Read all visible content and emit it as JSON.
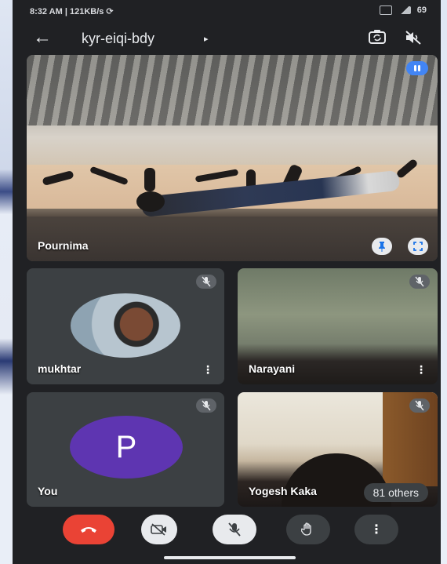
{
  "status_bar": {
    "time_speed": "8:32 AM | 121KB/s ⟳",
    "battery": "69"
  },
  "meeting": {
    "code": "kyr-eiqi-bdy",
    "caret": "▸",
    "back_glyph": "←"
  },
  "main_tile": {
    "participant": "Pournima"
  },
  "tiles": [
    {
      "participant": "mukhtar",
      "muted": true
    },
    {
      "participant": "Narayani",
      "muted": true
    },
    {
      "participant": "You",
      "avatar_letter": "P",
      "muted": true
    },
    {
      "participant": "Yogesh Kaka",
      "muted": true
    }
  ],
  "others_count_label": "81 others",
  "icons": {
    "back": "arrow-left-icon",
    "switch_camera": "switch-camera-icon",
    "speaker": "speaker-off-icon",
    "pin": "pin-icon",
    "fullscreen": "fullscreen-icon",
    "mic_off": "mic-off-icon",
    "end_call": "phone-hangup-icon",
    "camera_off": "camera-off-icon",
    "hand": "raise-hand-icon",
    "more": "more-vert-icon"
  },
  "colors": {
    "end_call": "#ea4335",
    "accent": "#4285f4",
    "avatar_bg": "#5e35b1",
    "surface": "#202124"
  }
}
